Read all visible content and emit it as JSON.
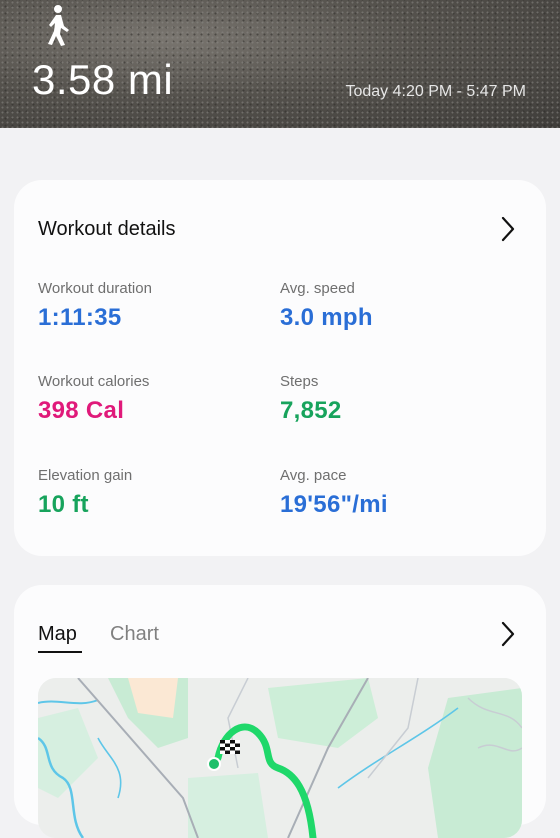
{
  "header": {
    "distance": "3.58 mi",
    "time_range": "Today 4:20 PM - 5:47 PM",
    "activity_icon": "walking-person-icon"
  },
  "workout_details": {
    "title": "Workout details",
    "stats": [
      {
        "label": "Workout duration",
        "value": "1:11:35",
        "color": "#2a6ed6"
      },
      {
        "label": "Avg. speed",
        "value": "3.0 mph",
        "color": "#2a6ed6"
      },
      {
        "label": "Workout calories",
        "value": "398 Cal",
        "color": "#e0197a"
      },
      {
        "label": "Steps",
        "value": "7,852",
        "color": "#17a35c"
      },
      {
        "label": "Elevation gain",
        "value": "10 ft",
        "color": "#17a35c"
      },
      {
        "label": "Avg. pace",
        "value": "19'56\"/mi",
        "color": "#2a6ed6"
      }
    ]
  },
  "map_section": {
    "tabs": [
      {
        "label": "Map",
        "active": true
      },
      {
        "label": "Chart",
        "active": false
      }
    ]
  },
  "colors": {
    "route": "#1fd86a",
    "accent_blue": "#2a6ed6",
    "accent_pink": "#e0197a",
    "accent_green": "#17a35c"
  }
}
